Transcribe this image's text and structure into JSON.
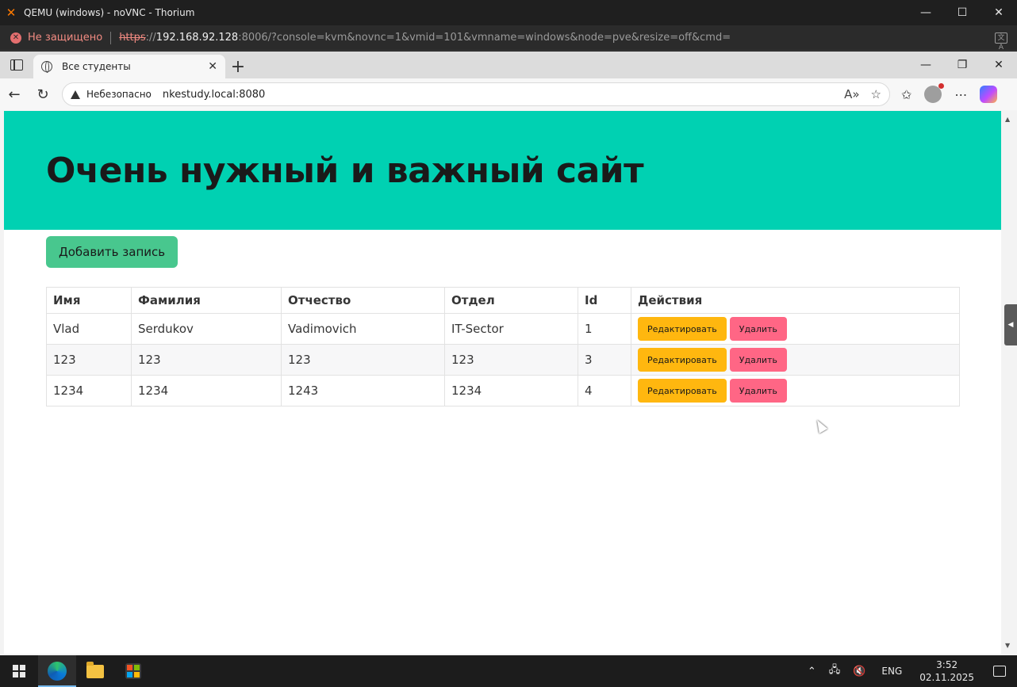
{
  "outer_window": {
    "title": "QEMU (windows) - noVNC - Thorium",
    "security_warning": "Не защищено",
    "url_scheme": "https",
    "url_separator": "://",
    "url_host": "192.168.92.128",
    "url_rest": ":8006/?console=kvm&novnc=1&vmid=101&vmname=windows&node=pve&resize=off&cmd="
  },
  "browser": {
    "tab_title": "Все студенты",
    "security_label": "Небезопасно",
    "url": "nkestudy.local:8080"
  },
  "page": {
    "heading": "Очень нужный и важный сайт",
    "add_button": "Добавить запись",
    "table": {
      "headers": [
        "Имя",
        "Фамилия",
        "Отчество",
        "Отдел",
        "Id",
        "Действия"
      ],
      "rows": [
        [
          "Vlad",
          "Serdukov",
          "Vadimovich",
          "IT-Sector",
          "1"
        ],
        [
          "123",
          "123",
          "123",
          "123",
          "3"
        ],
        [
          "1234",
          "1234",
          "1243",
          "1234",
          "4"
        ]
      ],
      "edit_label": "Редактировать",
      "delete_label": "Удалить"
    }
  },
  "taskbar": {
    "language": "ENG",
    "time": "3:52",
    "date": "02.11.2025"
  }
}
